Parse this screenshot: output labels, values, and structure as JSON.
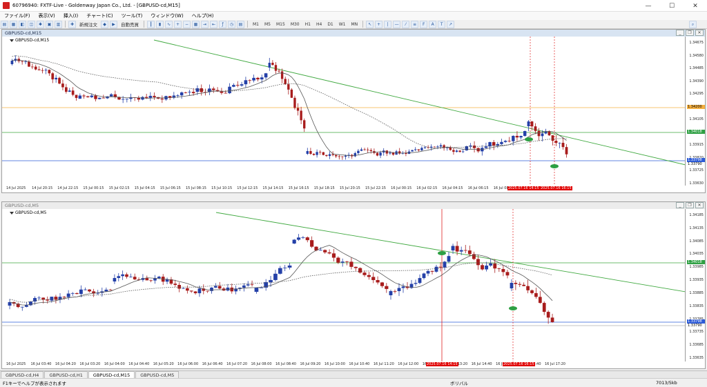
{
  "app": {
    "title": "60796940: FXTF-Live - Goldenway Japan Co., Ltd. - [GBPUSD-cd,M15]"
  },
  "window_controls": {
    "minimize": "—",
    "maximize": "☐",
    "close": "✕"
  },
  "menu": [
    "ファイル(F)",
    "表示(V)",
    "挿入(I)",
    "チャート(C)",
    "ツール(T)",
    "ウィンドウ(W)",
    "ヘルプ(H)"
  ],
  "toolbar": {
    "new_order": "新規注文",
    "auto_trade": "自動売買",
    "timeframes": [
      "M1",
      "M5",
      "M15",
      "M30",
      "H1",
      "H4",
      "D1",
      "W1",
      "MN"
    ]
  },
  "chart1": {
    "title": "GBPUSD-cd,M15",
    "symbol_label": "GBPUSD-cd,M15",
    "price_labels": [
      "1.34675",
      "1.34580",
      "1.34485",
      "1.34390",
      "1.34295",
      "1.34200",
      "1.34105",
      "1.34010",
      "1.33915",
      "1.33820",
      "1.33725",
      "1.33630"
    ],
    "tags": [
      {
        "text": "1.34200",
        "color": "#f5b041",
        "textcolor": "#000"
      },
      {
        "text": "1.34018",
        "color": "#2ea043",
        "textcolor": "#fff"
      },
      {
        "text": "1.33798",
        "color": "#2d5bd7",
        "textcolor": "#fff"
      },
      {
        "text": "1.33790",
        "color": "#ffffff",
        "textcolor": "#000"
      }
    ],
    "time_labels": [
      "14 Jul 2025",
      "14 Jul 20:15",
      "14 Jul 22:15",
      "15 Jul 00:15",
      "15 Jul 02:15",
      "15 Jul 04:15",
      "15 Jul 06:15",
      "15 Jul 08:15",
      "15 Jul 10:15",
      "15 Jul 12:15",
      "15 Jul 14:15",
      "15 Jul 16:15",
      "15 Jul 18:15",
      "15 Jul 20:15",
      "15 Jul 22:15",
      "16 Jul 00:15",
      "16 Jul 02:15",
      "16 Jul 04:15",
      "16 Jul 06:15",
      "16 Jul 08:15",
      "16 Jul 10:15",
      "16 Jul 12:15"
    ],
    "red_time_labels": [
      "2025.07.16 14:15",
      "2025.07.16 16:15"
    ]
  },
  "chart2": {
    "title": "GBPUSD-cd,M5",
    "symbol_label": "GBPUSD-cd,M5",
    "price_labels": [
      "1.34185",
      "1.34135",
      "1.34085",
      "1.34035",
      "1.33985",
      "1.33935",
      "1.33885",
      "1.33835",
      "1.33785",
      "1.33735",
      "1.33685",
      "1.33635"
    ],
    "tags": [
      {
        "text": "1.34018",
        "color": "#2ea043",
        "textcolor": "#fff"
      },
      {
        "text": "1.33798",
        "color": "#2d5bd7",
        "textcolor": "#fff"
      },
      {
        "text": "1.33790",
        "color": "#ffffff",
        "textcolor": "#000"
      }
    ],
    "time_labels": [
      "16 Jul 2025",
      "16 Jul 03:40",
      "16 Jul 04:20",
      "16 Jul 03:20",
      "16 Jul 04:00",
      "16 Jul 04:40",
      "16 Jul 05:20",
      "16 Jul 06:00",
      "16 Jul 06:40",
      "16 Jul 07:20",
      "16 Jul 08:00",
      "16 Jul 08:40",
      "16 Jul 09:20",
      "16 Jul 10:00",
      "16 Jul 10:40",
      "16 Jul 11:20",
      "16 Jul 12:00",
      "16 Jul 12:40",
      "16 Jul 13:20",
      "16 Jul 14:40",
      "16 Jul 15:20",
      "16 Jul 16:40",
      "16 Jul 17:20"
    ],
    "red_time_labels": [
      "2025.07.16 14:15",
      "2025.07.16 16:15"
    ]
  },
  "tabs": [
    "GBPUSD-cd,H4",
    "GBPUSD-cd,H1",
    "GBPUSD-cd,M15",
    "GBPUSD-cd,M5"
  ],
  "active_tab": "GBPUSD-cd,M15",
  "status": {
    "left": "F1キーでヘルプが表示されます",
    "middle": "ボリバル",
    "right": "7013/5kb"
  },
  "colors": {
    "bull": "#2440a8",
    "bear": "#a81c1c",
    "trend": "#3ea83e",
    "sma": "#555555",
    "red_line": "#e02020"
  }
}
